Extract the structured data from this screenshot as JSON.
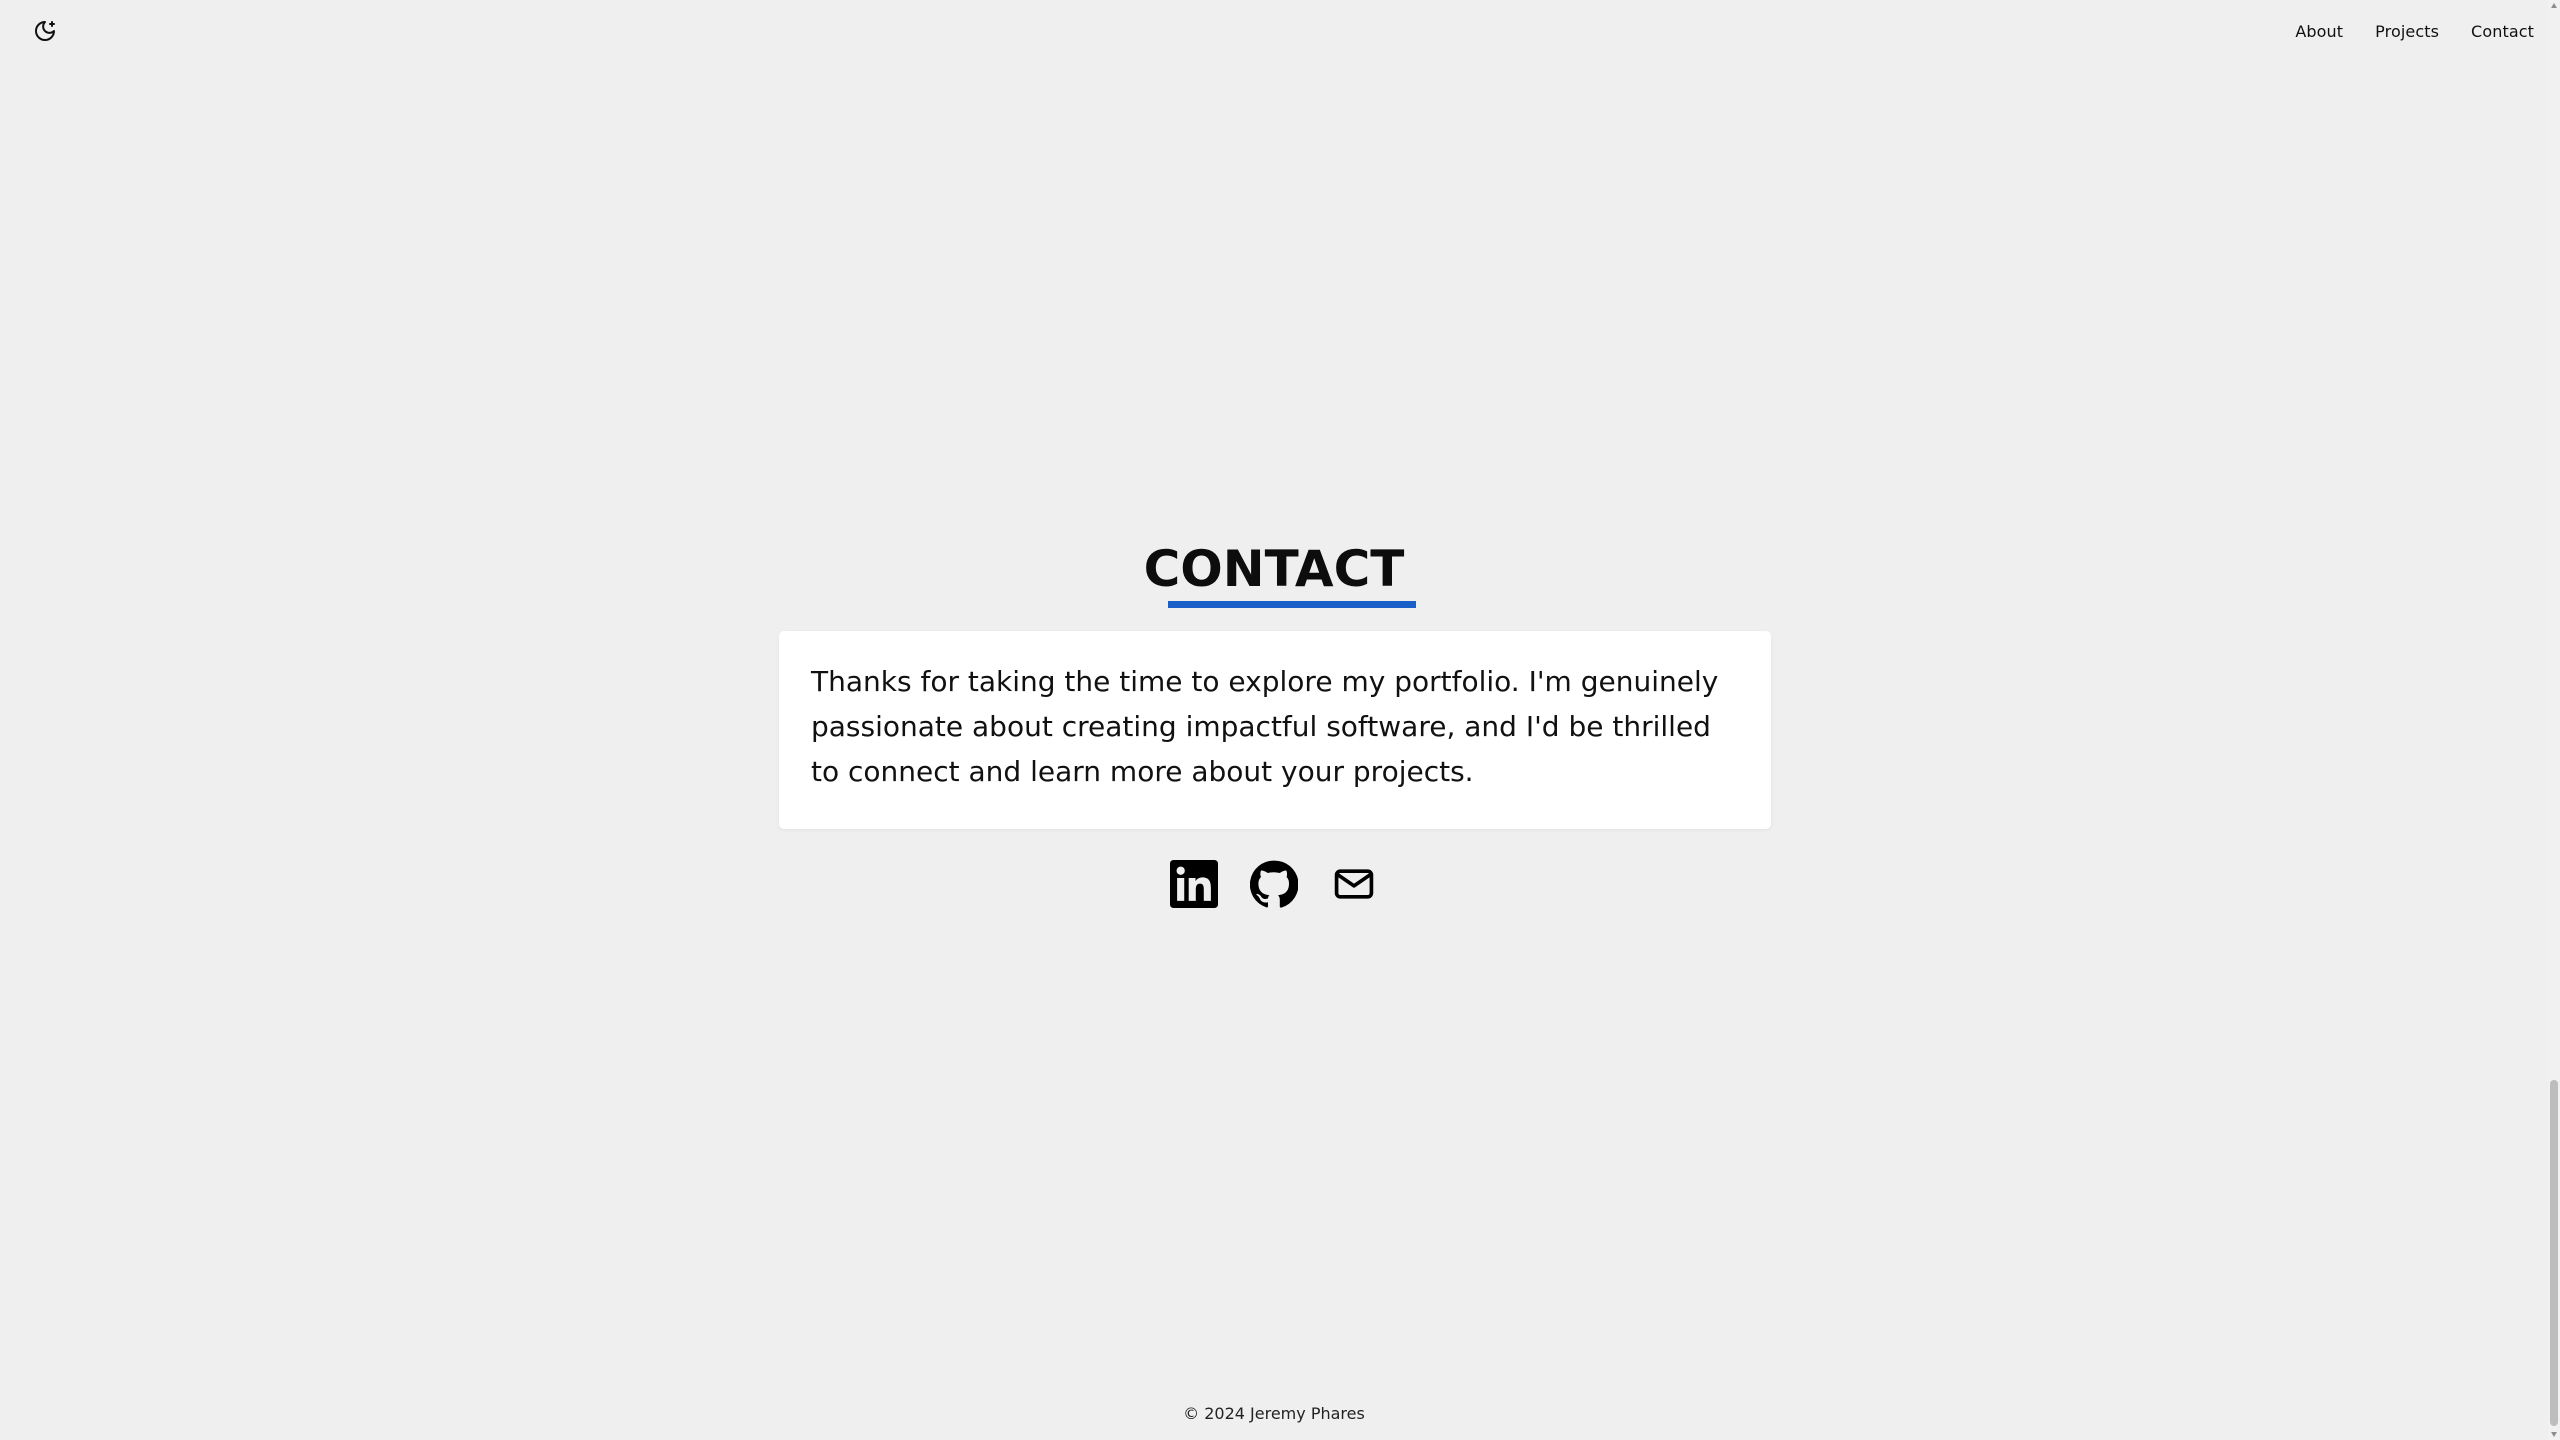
{
  "header": {
    "theme_toggle_icon": "moon-sun-icon",
    "nav": [
      {
        "label": "About"
      },
      {
        "label": "Projects"
      },
      {
        "label": "Contact"
      }
    ]
  },
  "main": {
    "title": "CONTACT",
    "accent_color": "#1a5fc7",
    "message": "Thanks for taking the time to explore my portfolio. I'm genuinely passionate about creating impactful software, and I'd be thrilled to connect and learn more about your projects.",
    "socials": [
      {
        "icon": "linkedin-icon"
      },
      {
        "icon": "github-icon"
      },
      {
        "icon": "email-icon"
      }
    ]
  },
  "footer": {
    "copyright": "© 2024 Jeremy Phares"
  }
}
